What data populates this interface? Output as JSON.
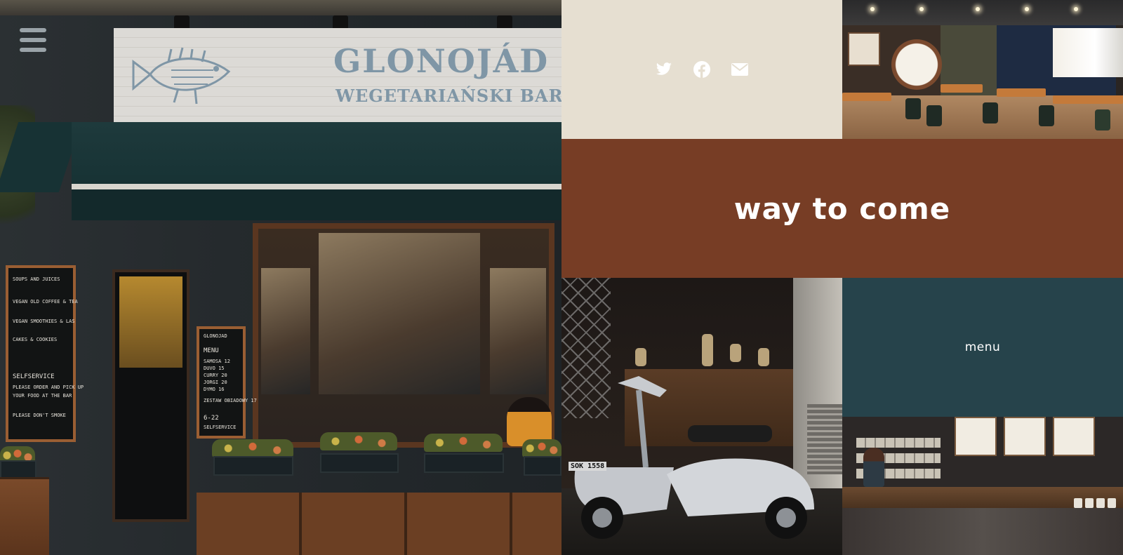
{
  "nav": {
    "menu_icon": "hamburger-menu-icon"
  },
  "storefront": {
    "sign_title": "GLONOJÁD",
    "sign_subtitle": "WEGETARIAŃSKI BAR",
    "board_left_lines": [
      "SOUPS AND JUICES",
      "VEGAN OLD COFFEE & TEA",
      "VEGAN SMOOTHIES & LAS",
      "CAKES & COOKIES",
      "SELFSERVICE",
      "PLEASE ORDER AND PICK UP",
      "YOUR FOOD AT THE BAR",
      "PLEASE DON'T SMOKE"
    ],
    "board_mid_lines": [
      "GLONOJAD",
      "MENU",
      "SAMOSA 12",
      "DUVO 15",
      "CURRY 20",
      "JORGI 20",
      "DYMO 16",
      "ZESTAW OBIADOWY 17",
      "6-22",
      "SELFSERVICE"
    ]
  },
  "social": {
    "icons": [
      "twitter-icon",
      "facebook-icon",
      "email-icon"
    ]
  },
  "hero": {
    "title": "way to come"
  },
  "menu": {
    "label": "menu"
  },
  "scooter": {
    "plate": "SOK 1558"
  },
  "colors": {
    "social_bg": "#e6dfd1",
    "title_bg": "#773d25",
    "menu_bg": "#26434b",
    "text_light": "#ffffff"
  }
}
